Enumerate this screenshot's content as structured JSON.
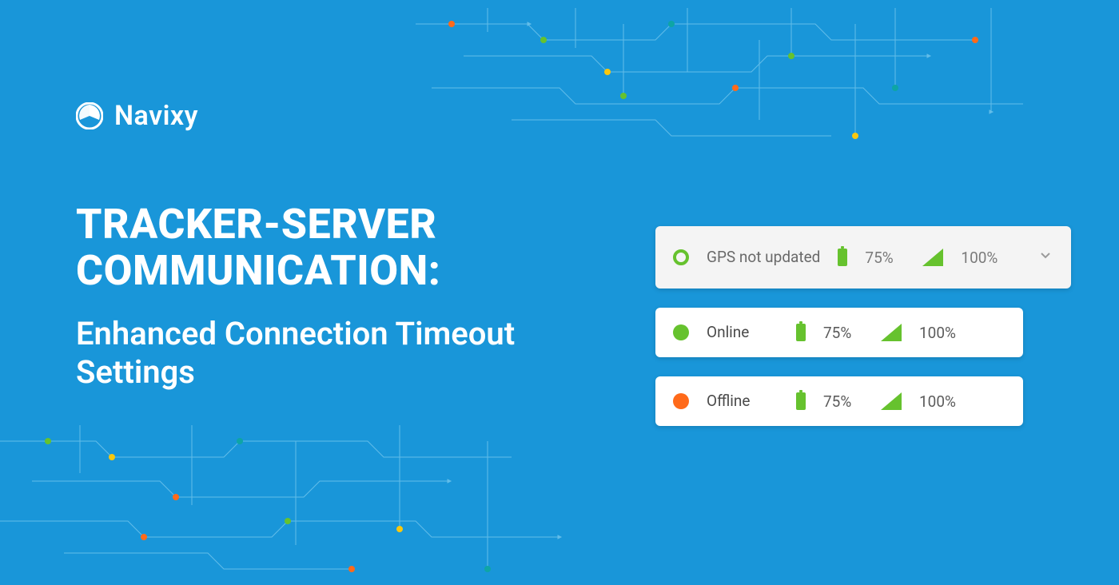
{
  "brand": {
    "name": "Navixy"
  },
  "headline": {
    "title": "TRACKER-SERVER COMMUNICATION:",
    "subtitle": "Enhanced Connection Timeout Settings"
  },
  "status_cards": [
    {
      "kind": "gps_not_updated",
      "label": "GPS not updated",
      "icon_style": "ring",
      "battery_pct": "75%",
      "signal_pct": "100%",
      "expandable": true,
      "dim": true
    },
    {
      "kind": "online",
      "label": "Online",
      "icon_style": "solid-green",
      "battery_pct": "75%",
      "signal_pct": "100%",
      "expandable": false,
      "dim": false
    },
    {
      "kind": "offline",
      "label": "Offline",
      "icon_style": "solid-orange",
      "battery_pct": "75%",
      "signal_pct": "100%",
      "expandable": false,
      "dim": false
    }
  ],
  "colors": {
    "background": "#1996d9",
    "green": "#66c22e",
    "orange": "#ff6a1a",
    "yellow": "#f9c80e",
    "teal": "#0ea5a5"
  }
}
